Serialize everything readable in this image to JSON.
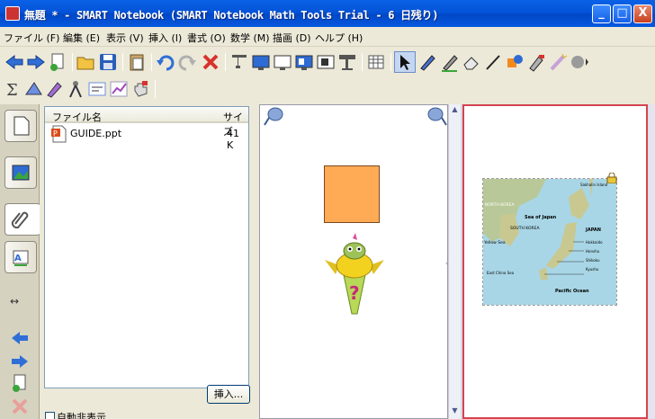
{
  "window": {
    "title": "無題 * - SMART Notebook (SMART Notebook Math Tools Trial - 6 日残り)",
    "controls": {
      "minimize": "_",
      "maximize": "□",
      "close": "X"
    }
  },
  "menu": [
    "ファイル (F)",
    "編集 (E)",
    "表示 (V)",
    "挿入 (I)",
    "書式 (O)",
    "数学 (M)",
    "描画 (D)",
    "ヘルプ (H)"
  ],
  "toolbar": {
    "row1_icons": [
      "back-arrow-icon",
      "forward-arrow-icon",
      "new-page-icon",
      "open-folder-icon",
      "save-icon",
      "paste-icon",
      "undo-icon",
      "redo-icon",
      "delete-icon",
      "screen-shade-icon",
      "full-screen-icon",
      "dual-page-icon",
      "show-screen-icon",
      "capture-icon",
      "document-camera-icon",
      "table-icon",
      "select-icon",
      "pen-icon",
      "creative-pen-icon",
      "eraser-icon",
      "line-icon",
      "shapes-icon",
      "fill-icon",
      "magic-pen-icon",
      "properties-icon"
    ],
    "row2_icons": [
      "sigma-icon",
      "math-shapes-icon",
      "math-pen-icon",
      "compass-icon",
      "equation-icon",
      "graph-icon",
      "hand-icon"
    ]
  },
  "sidebar_tabs": [
    "page-sorter-tab",
    "gallery-tab",
    "attachments-tab",
    "properties-tab"
  ],
  "side_nav": {
    "resize": "↔"
  },
  "attachments": {
    "columns": {
      "name": "ファイル名",
      "size": "サイズ"
    },
    "files": [
      {
        "name": "GUIDE.ppt",
        "size": "41 K",
        "icon": "powerpoint-file-icon"
      }
    ],
    "insert_button": "挿入...",
    "autohide_label": "自動非表示",
    "autohide_checked": false
  },
  "map": {
    "labels": {
      "sakhalin": "Sakhalin Island",
      "north_korea": "NORTH KOREA",
      "sea_of_japan": "Sea of Japan",
      "south_korea": "SOUTH KOREA",
      "yellow_sea": "Yellow Sea",
      "japan": "JAPAN",
      "hokkaido": "Hokkaido",
      "honshu": "Honshu",
      "shikoku": "Shikoku",
      "kyushu": "Kyushu",
      "east_china_sea": "East China Sea",
      "pacific_ocean": "Pacific Ocean"
    }
  },
  "colors": {
    "accent": "#0353d8",
    "page_border": "#d34550",
    "square": "#ffaa55",
    "square_border": "#7a4a1f"
  }
}
